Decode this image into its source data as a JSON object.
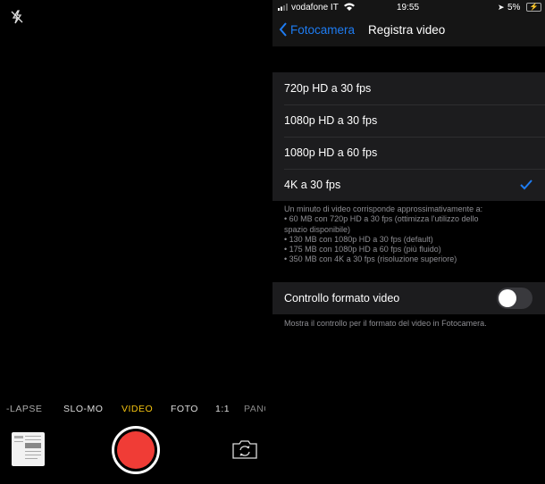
{
  "camera": {
    "modes": [
      "-LAPSE",
      "SLO-MO",
      "VIDEO",
      "FOTO",
      "1:1",
      "PANO"
    ],
    "selected_mode": "VIDEO",
    "accent": "#f5c40f",
    "shutter_color": "#f03c36"
  },
  "status": {
    "carrier": "vodafone IT",
    "time": "19:55",
    "battery": "5%"
  },
  "nav": {
    "back_label": "Fotocamera",
    "title": "Registra video",
    "accent": "#1e7cf2"
  },
  "options": [
    {
      "label": "720p HD a 30 fps",
      "selected": false
    },
    {
      "label": "1080p HD a 30 fps",
      "selected": false
    },
    {
      "label": "1080p HD a 60 fps",
      "selected": false
    },
    {
      "label": "4K a 30 fps",
      "selected": true
    }
  ],
  "options_footer": [
    "Un minuto di video corrisponde approssimativamente a:",
    "• 60 MB con 720p HD a 30 fps (ottimizza l'utilizzo dello",
    "spazio disponibile)",
    "• 130 MB con 1080p HD a 30 fps (default)",
    "• 175 MB con 1080p HD a 60 fps (più fluido)",
    "• 350 MB con 4K a 30 fps (risoluzione superiore)"
  ],
  "format_control": {
    "label": "Controllo formato video",
    "enabled": false,
    "footer": "Mostra il controllo per il formato del video in Fotocamera."
  }
}
